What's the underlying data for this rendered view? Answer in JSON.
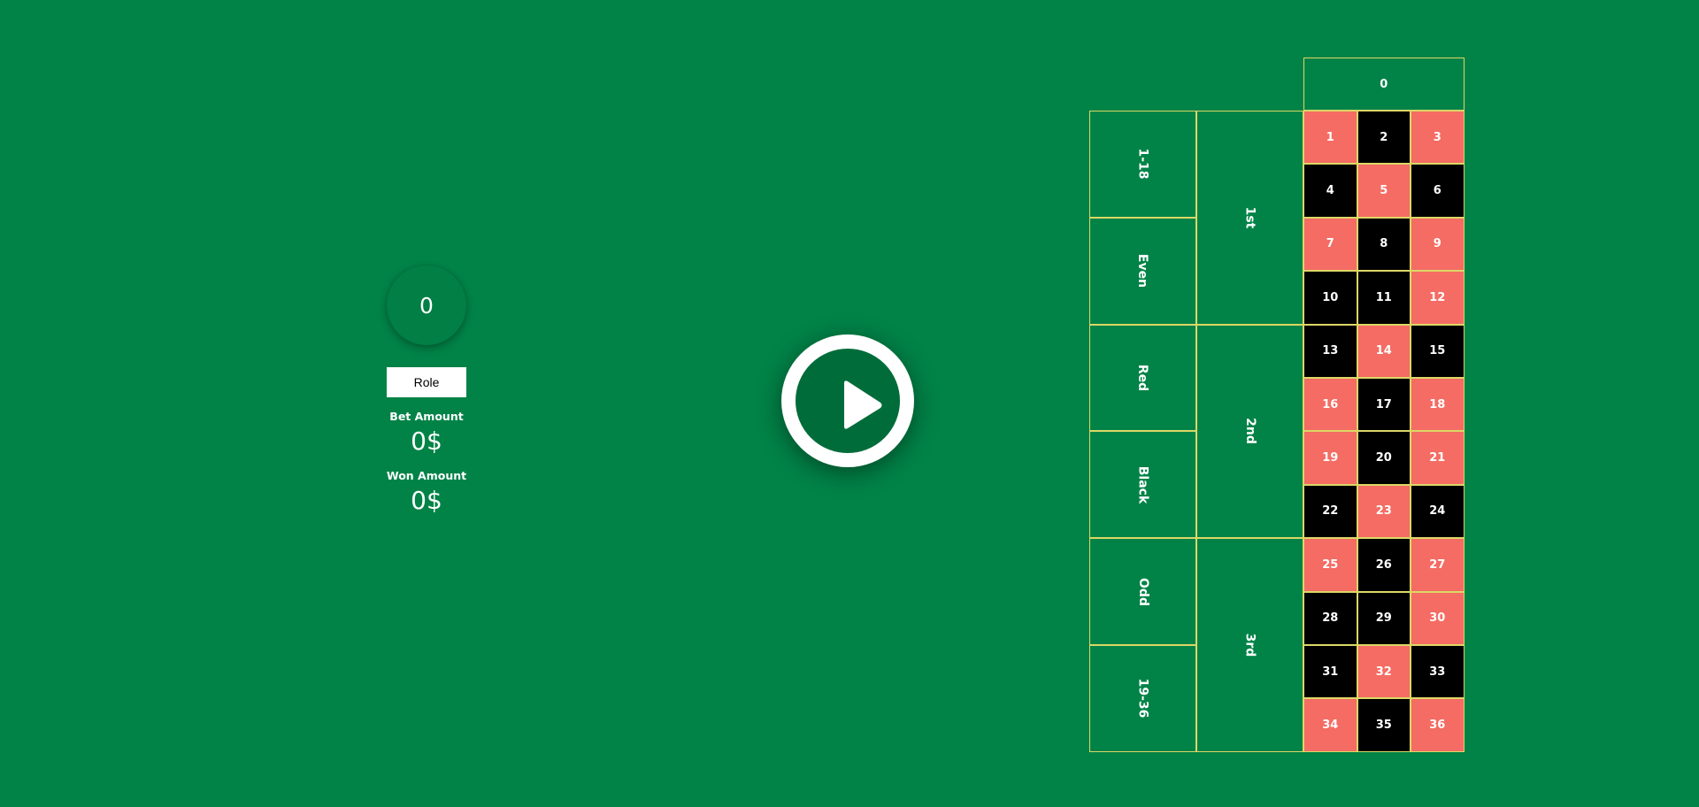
{
  "panel": {
    "result": "0",
    "role_label": "Role",
    "bet_label": "Bet Amount",
    "bet_value": "0$",
    "won_label": "Won Amount",
    "won_value": "0$"
  },
  "play_button": {
    "icon": "play-icon"
  },
  "board": {
    "zero": "0",
    "outside_bets": [
      "1-18",
      "Even",
      "Red",
      "Black",
      "Odd",
      "19-36"
    ],
    "dozens": [
      "1st",
      "2nd",
      "3rd"
    ],
    "numbers": [
      [
        "1",
        "2",
        "3"
      ],
      [
        "4",
        "5",
        "6"
      ],
      [
        "7",
        "8",
        "9"
      ],
      [
        "10",
        "11",
        "12"
      ],
      [
        "13",
        "14",
        "15"
      ],
      [
        "16",
        "17",
        "18"
      ],
      [
        "19",
        "20",
        "21"
      ],
      [
        "22",
        "23",
        "24"
      ],
      [
        "25",
        "26",
        "27"
      ],
      [
        "28",
        "29",
        "30"
      ],
      [
        "31",
        "32",
        "33"
      ],
      [
        "34",
        "35",
        "36"
      ]
    ],
    "colors": [
      [
        "red",
        "black",
        "red"
      ],
      [
        "black",
        "red",
        "black"
      ],
      [
        "red",
        "black",
        "red"
      ],
      [
        "black",
        "black",
        "red"
      ],
      [
        "black",
        "red",
        "black"
      ],
      [
        "red",
        "black",
        "red"
      ],
      [
        "red",
        "black",
        "red"
      ],
      [
        "black",
        "red",
        "black"
      ],
      [
        "red",
        "black",
        "red"
      ],
      [
        "black",
        "black",
        "red"
      ],
      [
        "black",
        "red",
        "black"
      ],
      [
        "red",
        "black",
        "red"
      ]
    ],
    "palette": {
      "red": "#f46c63",
      "black": "#000000",
      "felt": "#018347",
      "line": "#dcd766"
    }
  }
}
